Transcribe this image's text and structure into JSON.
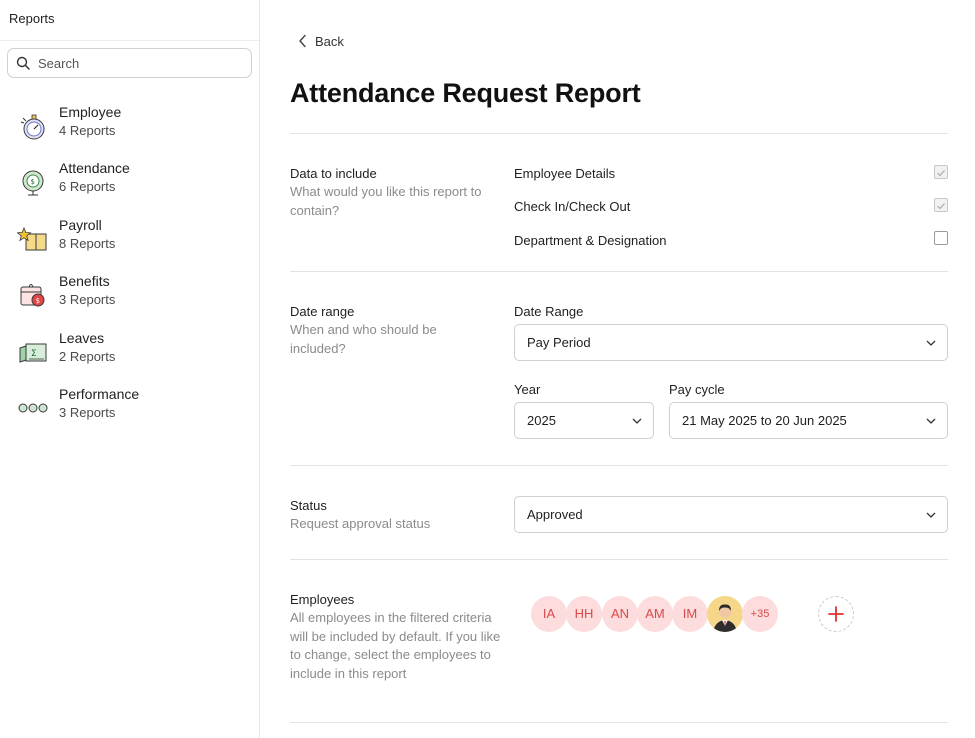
{
  "sidebar": {
    "title": "Reports",
    "search": {
      "placeholder": "Search",
      "value": ""
    },
    "items": [
      {
        "name": "Employee",
        "count": "4 Reports",
        "icon": "stopwatch-icon"
      },
      {
        "name": "Attendance",
        "count": "6 Reports",
        "icon": "globe-clock-icon"
      },
      {
        "name": "Payroll",
        "count": "8 Reports",
        "icon": "gift-star-icon"
      },
      {
        "name": "Benefits",
        "count": "3 Reports",
        "icon": "calendar-coin-icon"
      },
      {
        "name": "Leaves",
        "count": "2 Reports",
        "icon": "ledger-icon"
      },
      {
        "name": "Performance",
        "count": "3 Reports",
        "icon": "rings-icon"
      }
    ]
  },
  "main": {
    "back_label": "Back",
    "title": "Attendance Request Report",
    "data_section": {
      "label": "Data to include",
      "description": "What would you like this report to contain?",
      "options": [
        {
          "label": "Employee Details",
          "checked": true
        },
        {
          "label": "Check In/Check Out",
          "checked": true
        },
        {
          "label": "Department & Designation",
          "checked": false
        }
      ]
    },
    "date_section": {
      "label": "Date range",
      "description": "When and who should be included?",
      "date_range_label": "Date Range",
      "date_range_value": "Pay Period",
      "year_label": "Year",
      "year_value": "2025",
      "pay_cycle_label": "Pay cycle",
      "pay_cycle_value": "21 May 2025 to 20 Jun 2025"
    },
    "status_section": {
      "label": "Status",
      "description": "Request approval status",
      "value": "Approved"
    },
    "employees_section": {
      "label": "Employees",
      "description": "All employees in the filtered criteria will be included by default. If you like to change, select the employees to include in this report",
      "avatars": [
        "IA",
        "HH",
        "AN",
        "AM",
        "IM"
      ],
      "more_count": "+35"
    }
  },
  "colors": {
    "avatar_bg": "#fcdcdc",
    "avatar_text": "#d84a4a",
    "add_icon": "#e03030"
  }
}
